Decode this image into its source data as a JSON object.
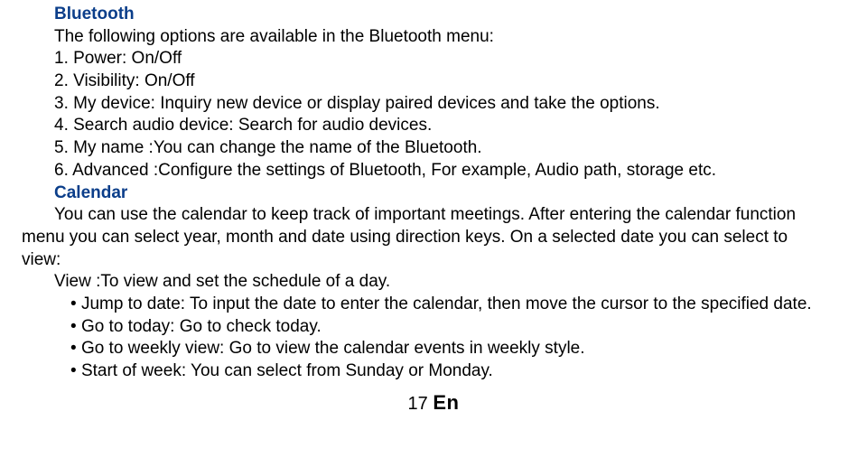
{
  "section1": {
    "title": "Bluetooth",
    "intro": "The following options are available in the Bluetooth menu:",
    "items": [
      "1. Power: On/Off",
      "2. Visibility: On/Off",
      "3. My device: Inquiry new device or display paired devices and take the options.",
      "4. Search audio device: Search for audio devices.",
      "5. My name :You can change the name of the Bluetooth.",
      "6. Advanced :Configure the settings of Bluetooth, For example, Audio path, storage etc."
    ]
  },
  "section2": {
    "title": "Calendar",
    "para_indent": "You can use the calendar to keep track of important meetings. After entering the calendar function",
    "para_noindent1": "menu you can select year, month and date using direction keys. On a selected date you can select to",
    "para_noindent2": "view:",
    "line1": "View :To view and set the schedule of a day.",
    "bullets": [
      "Jump to date: To input the date to enter the calendar, then move the cursor to the specified date.",
      "Go to today: Go to check today.",
      "Go to weekly view: Go to view the calendar events in weekly style.",
      "Start of week: You can select from Sunday or Monday."
    ]
  },
  "footer": {
    "page_number": "17",
    "lang": "En"
  }
}
